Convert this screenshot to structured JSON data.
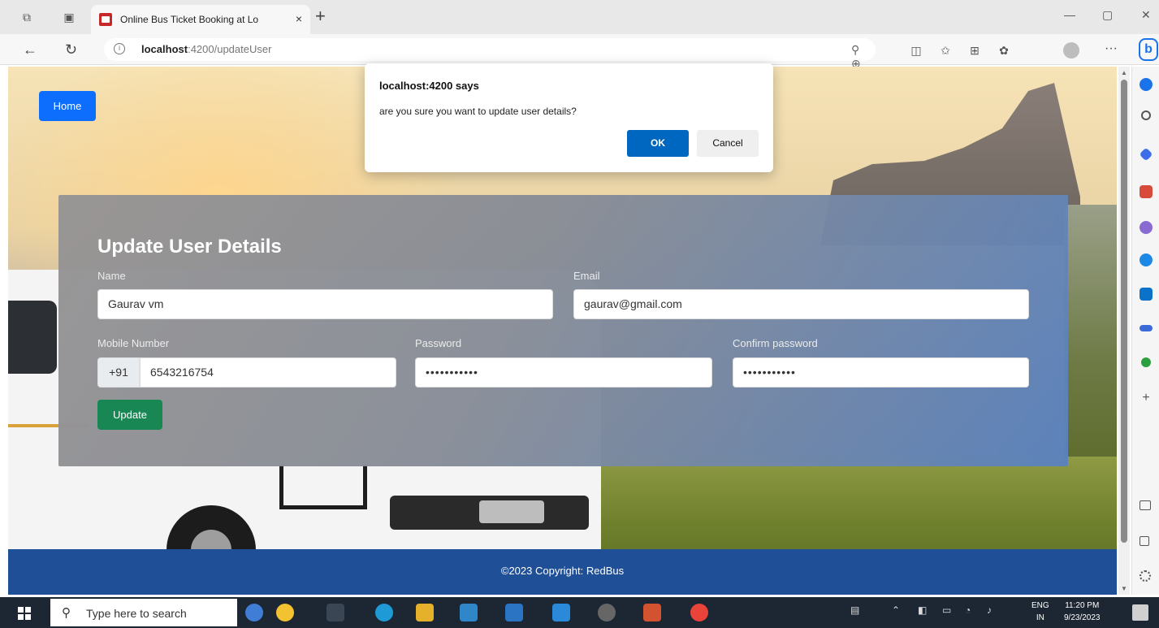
{
  "browser": {
    "tab_title": "Online Bus Ticket Booking at Lo",
    "tab_close": "×",
    "new_tab": "+",
    "url_host": "localhost",
    "url_rest": ":4200/updateUser",
    "more": "···",
    "bing": "b",
    "window_minimize": "—",
    "window_restore": "▢",
    "window_close": "✕"
  },
  "page": {
    "home_button": "Home",
    "form": {
      "title": "Update User Details",
      "name_label": "Name",
      "name_value": "Gaurav vm",
      "email_label": "Email",
      "email_value": "gaurav@gmail.com",
      "mobile_label": "Mobile Number",
      "mobile_prefix": "+91",
      "mobile_value": "6543216754",
      "password_label": "Password",
      "password_value": "•••••••••••",
      "confirm_label": "Confirm password",
      "confirm_value": "•••••••••••",
      "update_button": "Update"
    },
    "footer": "©2023 Copyright: RedBus"
  },
  "dialog": {
    "title": "localhost:4200 says",
    "message": "are you sure you want to update user details?",
    "ok": "OK",
    "cancel": "Cancel"
  },
  "taskbar": {
    "search_placeholder": "Type here to search",
    "lang_top": "ENG",
    "lang_bottom": "IN",
    "time": "11:20 PM",
    "date": "9/23/2023"
  },
  "colors": {
    "primary": "#0d6efd",
    "success": "#198754",
    "footer": "#1f4f96",
    "dialog_ok": "#0067c0"
  },
  "icons": [
    "workspaces-icon",
    "tab-actions-icon",
    "back-icon",
    "refresh-icon",
    "info-icon",
    "read-aloud-icon",
    "favorites-icon",
    "split-screen-icon",
    "collections-icon",
    "extensions-icon",
    "profile-icon",
    "search-icon",
    "windows-start-icon",
    "clock-icon"
  ]
}
